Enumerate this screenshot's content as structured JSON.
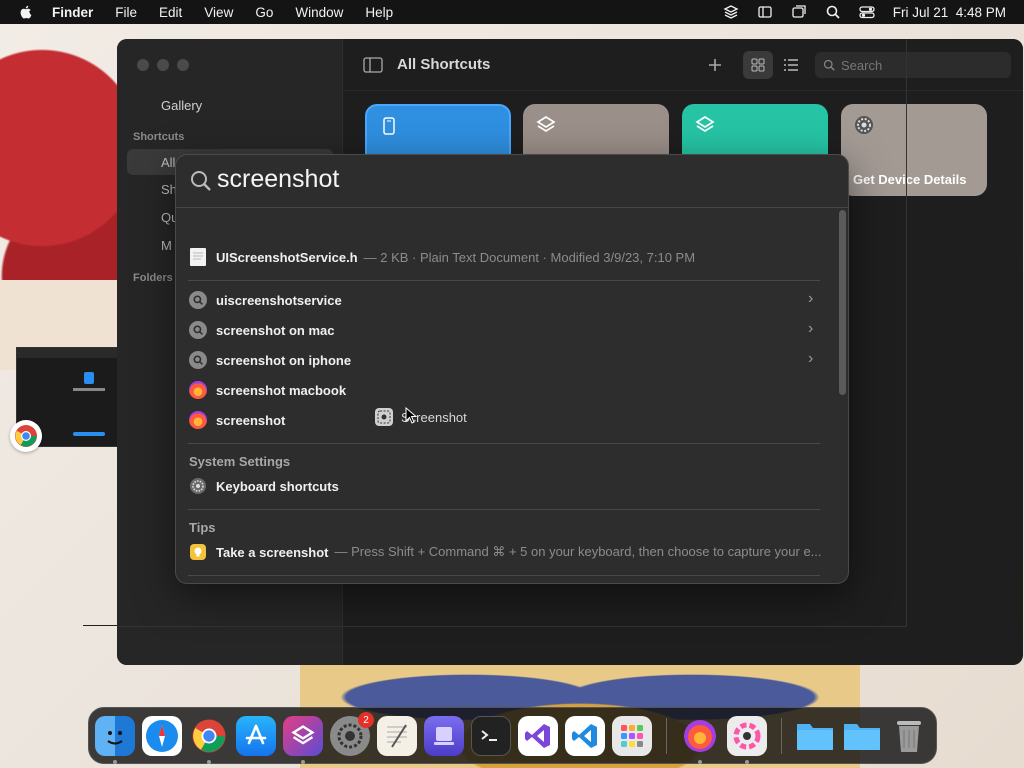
{
  "menubar": {
    "app": "Finder",
    "items": [
      "File",
      "Edit",
      "View",
      "Go",
      "Window",
      "Help"
    ],
    "clock": "Fri Jul 21  4:48 PM"
  },
  "shortcuts_window": {
    "sidebar": {
      "gallery": "Gallery",
      "shortcuts_header": "Shortcuts",
      "items": [
        "All",
        "Sh",
        "Qu",
        "M"
      ],
      "folders_header": "Folders"
    },
    "toolbar": {
      "title": "All Shortcuts",
      "search_placeholder": "Search"
    },
    "cards": [
      {
        "label": "",
        "color": "#2f8fe0"
      },
      {
        "label": "",
        "color": "#9b8f89"
      },
      {
        "label": "",
        "color": "#26c4a5"
      },
      {
        "label": "Get Device Details",
        "color": "#a39a94"
      }
    ]
  },
  "spotlight": {
    "query": "screenshot",
    "file_result": {
      "name": "UIScreenshotService.h",
      "meta": "— 2 KB · Plain Text Document · Modified 3/9/23, 7:10 PM"
    },
    "suggestions": [
      {
        "text": "uiscreenshotservice",
        "kind": "search",
        "chevron": true
      },
      {
        "text": "screenshot on mac",
        "kind": "search",
        "chevron": true
      },
      {
        "text": "screenshot on iphone",
        "kind": "search",
        "chevron": true
      },
      {
        "text": "screenshot macbook",
        "kind": "firefox",
        "chevron": false
      },
      {
        "text": "screenshot",
        "kind": "firefox",
        "chevron": false
      }
    ],
    "drag_item": "Screenshot",
    "system_settings": {
      "header": "System Settings",
      "item": "Keyboard shortcuts"
    },
    "tips": {
      "header": "Tips",
      "title": "Take a screenshot",
      "detail": "— Press Shift + Command ⌘ + 5 on your keyboard, then choose to capture your e..."
    }
  },
  "dock": {
    "apps": [
      "finder-icon",
      "safari-icon",
      "chrome-icon",
      "app-store-icon",
      "shortcuts-icon",
      "system-settings-icon",
      "textedit-icon",
      "xcode-icon",
      "terminal-icon",
      "visual-studio-icon",
      "vscode-icon",
      "launchpad-icon",
      "firefox-icon",
      "color-picker-icon",
      "folder-icon",
      "folder-icon",
      "trash-icon"
    ],
    "settings_badge": "2"
  }
}
